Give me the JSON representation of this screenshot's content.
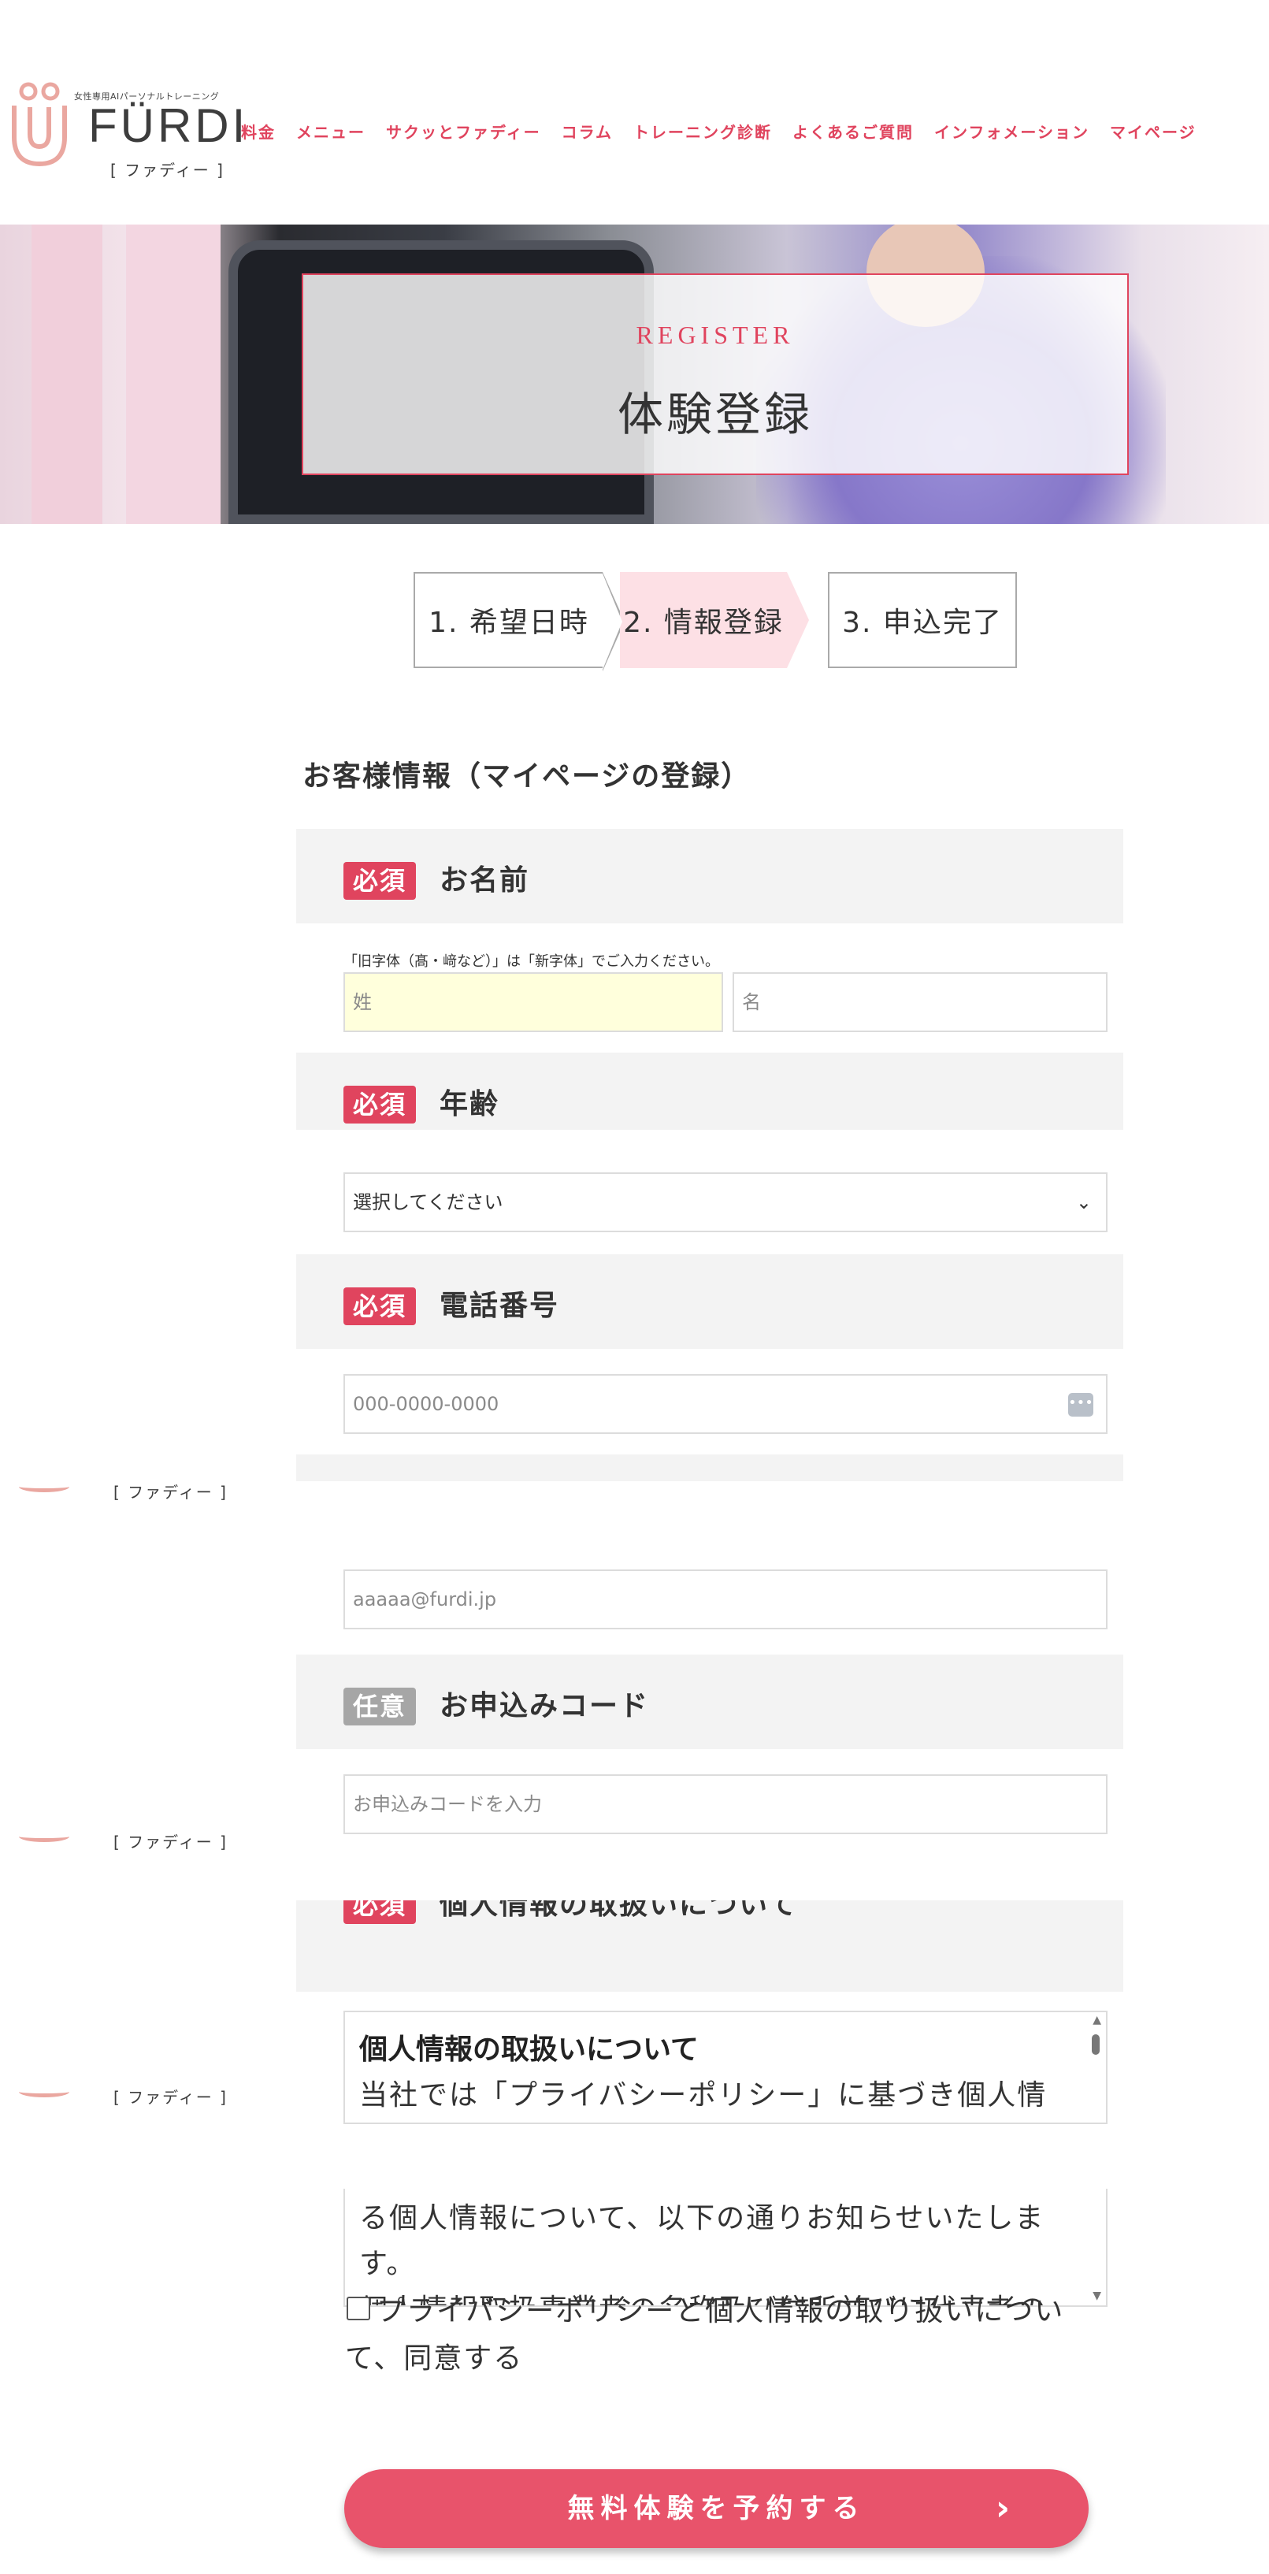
{
  "header": {
    "logo_tagline": "女性専用AIパーソナルトレーニング",
    "logo_name": "FÜRDI",
    "logo_sub": "[ ファディー ]",
    "nav": [
      "料金",
      "メニュー",
      "サクッとファディー",
      "コラム",
      "トレーニング診断",
      "よくあるご質問",
      "インフォメーション",
      "マイページ"
    ]
  },
  "hero": {
    "title_en": "REGISTER",
    "title_ja": "体験登録"
  },
  "steps": [
    "1. 希望日時",
    "2. 情報登録",
    "3. 申込完了"
  ],
  "section_title": "お客様情報（マイページの登録）",
  "badges": {
    "required": "必須",
    "optional": "任意"
  },
  "fields": {
    "name": {
      "label": "お名前",
      "hint": "「旧字体（髙・﨑など）」は「新字体」でご入力ください。",
      "last_placeholder": "姓",
      "first_placeholder": "名"
    },
    "age": {
      "label": "年齢",
      "selected": "選択してください"
    },
    "phone": {
      "label": "電話番号",
      "placeholder": "000-0000-0000",
      "icon": "password-manager-icon"
    },
    "email": {
      "placeholder": "aaaaa@furdi.jp"
    },
    "code": {
      "label": "お申込みコード",
      "placeholder": "お申込みコードを入力"
    },
    "privacy": {
      "label": "個人情報の取扱いについて",
      "box_title": "個人情報の取扱いについて",
      "text_line1": "当社では「プライバシーポリシー」に基づき個人情",
      "text_line2": "る個人情報について、以下の通りお知らせいたしま",
      "text_line3": "す。",
      "text_line4": "個人情報取扱事業者の名称及び住所並びに代表者の"
    }
  },
  "floating_logo_sub": "[ ファディー ]",
  "agree": {
    "line1": "プライバシーポリシーと個人情報の取り扱いについ",
    "line2": "て、同意する"
  },
  "submit": {
    "label": "無料体験を予約する",
    "arrow": "›"
  },
  "colors": {
    "accent": "#e0445e",
    "button": "#e8536b",
    "step_active": "#fde0e5",
    "field_head": "#f3f3f3",
    "focus": "#ffffdc"
  }
}
